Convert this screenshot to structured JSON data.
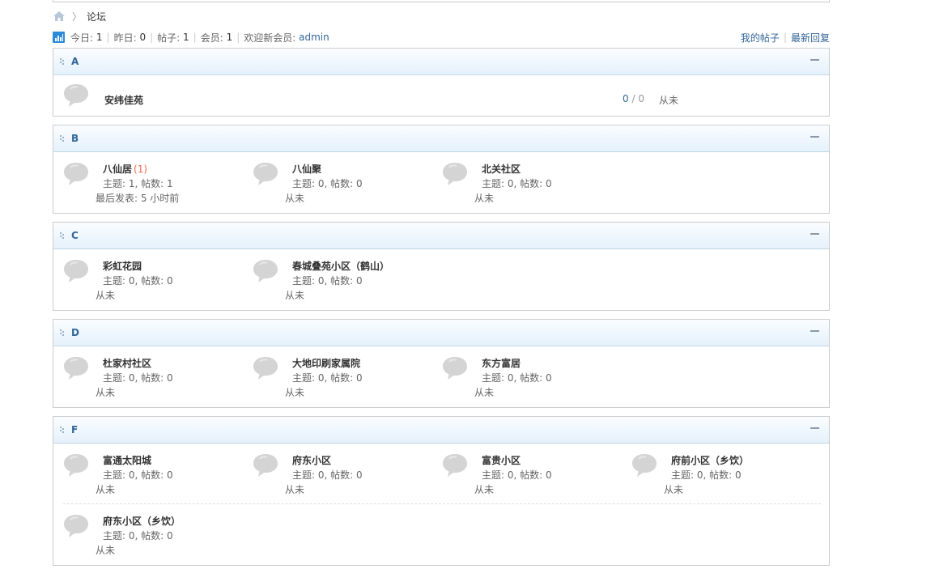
{
  "breadcrumb": {
    "current": "论坛",
    "separator": "〉"
  },
  "stats": {
    "today_label": "今日:",
    "today_value": "1",
    "yesterday_label": "昨日:",
    "yesterday_value": "0",
    "posts_label": "帖子:",
    "posts_value": "1",
    "members_label": "会员:",
    "members_value": "1",
    "welcome_label": "欢迎新会员:",
    "welcome_user": "admin",
    "my_posts": "我的帖子",
    "latest_replies": "最新回复",
    "pipe": "|"
  },
  "groups": {
    "a": {
      "name": "A",
      "forums": [
        {
          "name": "安纬佳苑",
          "threads": "0",
          "slash": "/",
          "posts": "0",
          "last": "从未"
        }
      ]
    },
    "b": {
      "name": "B",
      "forums": [
        {
          "name": "八仙居",
          "new": "(1)",
          "info": "主题: 1, 帖数: 1",
          "last": "最后发表: 5 小时前"
        },
        {
          "name": "八仙聚",
          "info": "主题: 0, 帖数: 0",
          "last": "从未"
        },
        {
          "name": "北关社区",
          "info": "主题: 0, 帖数: 0",
          "last": "从未"
        }
      ]
    },
    "c": {
      "name": "C",
      "forums": [
        {
          "name": "彩虹花园",
          "info": "主题: 0, 帖数: 0",
          "last": "从未"
        },
        {
          "name": "春城叠苑小区（鹤山）",
          "info": "主题: 0, 帖数: 0",
          "last": "从未"
        }
      ]
    },
    "d": {
      "name": "D",
      "forums": [
        {
          "name": "杜家村社区",
          "info": "主题: 0, 帖数: 0",
          "last": "从未"
        },
        {
          "name": "大地印刷家属院",
          "info": "主题: 0, 帖数: 0",
          "last": "从未"
        },
        {
          "name": "东方富居",
          "info": "主题: 0, 帖数: 0",
          "last": "从未"
        }
      ]
    },
    "f": {
      "name": "F",
      "forums": [
        {
          "name": "富通太阳城",
          "info": "主题: 0, 帖数: 0",
          "last": "从未"
        },
        {
          "name": "府东小区",
          "info": "主题: 0, 帖数: 0",
          "last": "从未"
        },
        {
          "name": "富贵小区",
          "info": "主题: 0, 帖数: 0",
          "last": "从未"
        },
        {
          "name": "府前小区（乡饮）",
          "info": "主题: 0, 帖数: 0",
          "last": "从未"
        },
        {
          "name": "府东小区（乡饮）",
          "info": "主题: 0, 帖数: 0",
          "last": "从未"
        }
      ]
    }
  },
  "colors": {
    "link": "#336699",
    "new_count": "#f26c4f",
    "header_bg": "#e5f1fc",
    "border": "#cdcdcd"
  },
  "icons": {
    "home": "home-icon",
    "stats": "stats-icon",
    "forum": "speech-bubble-icon",
    "collapse": "collapse-icon"
  }
}
